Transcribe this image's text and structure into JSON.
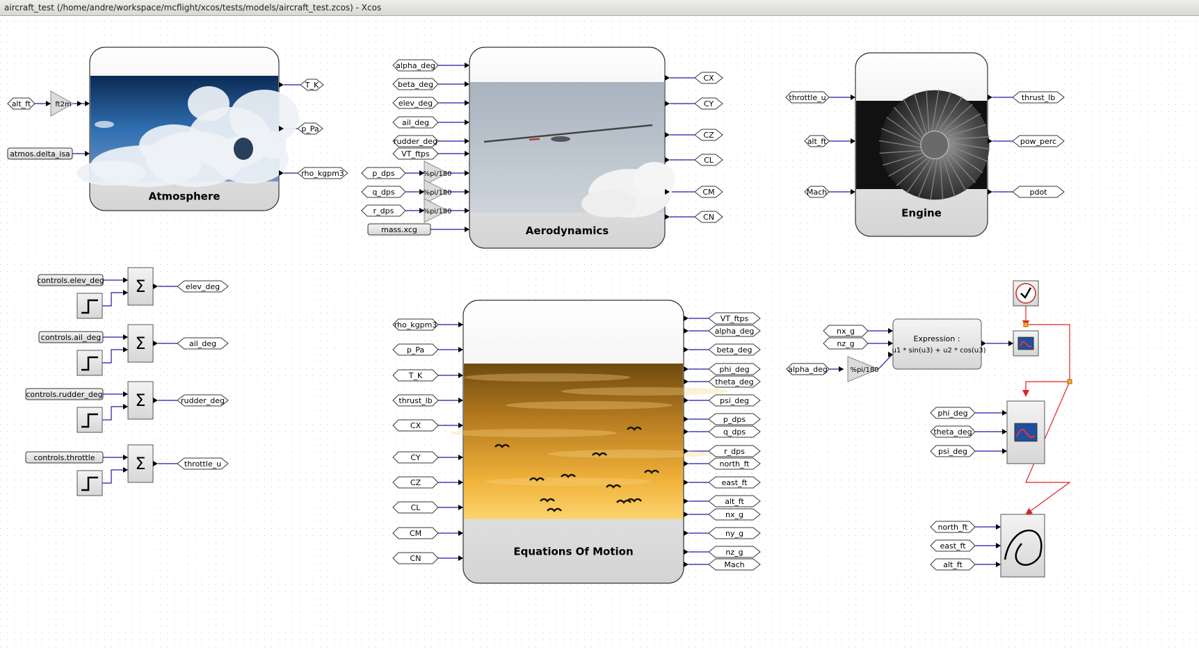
{
  "window": {
    "title": "aircraft_test (/home/andre/workspace/mcflight/xcos/tests/models/aircraft_test.zcos) - Xcos"
  },
  "superblocks": {
    "atmosphere": "Atmosphere",
    "aerodynamics": "Aerodynamics",
    "engine": "Engine",
    "eom": "Equations Of Motion"
  },
  "labels": {
    "alt_ft": "alt_ft",
    "ft2m": "ft2m",
    "atmos_delta_isa": "atmos.delta_isa",
    "T_K": "T_K",
    "p_Pa": "p_Pa",
    "rho_kgpm3": "rho_kgpm3",
    "alpha_deg": "alpha_deg",
    "beta_deg": "beta_deg",
    "elev_deg": "elev_deg",
    "ail_deg": "ail_deg",
    "rudder_deg": "rudder_deg",
    "VT_ftps": "VT_ftps",
    "p_dps": "p_dps",
    "q_dps": "q_dps",
    "r_dps": "r_dps",
    "pi180": "%pi/180",
    "mass_xcg": "mass.xcg",
    "CX": "CX",
    "CY": "CY",
    "CZ": "CZ",
    "CL": "CL",
    "CM": "CM",
    "CN": "CN",
    "throttle_u": "throttle_u",
    "Mach": "Mach",
    "thrust_lb": "thrust_lb",
    "pow_perc": "pow_perc",
    "pdot": "pdot",
    "controls_elev_deg": "controls.elev_deg",
    "controls_ail_deg": "controls.ail_deg",
    "controls_rudder_deg": "controls.rudder_deg",
    "controls_throttle": "controls.throttle",
    "phi_deg": "phi_deg",
    "theta_deg": "theta_deg",
    "psi_deg": "psi_deg",
    "north_ft": "north_ft",
    "east_ft": "east_ft",
    "nx_g": "nx_g",
    "ny_g": "ny_g",
    "nz_g": "nz_g",
    "expression_title": "Expression :",
    "expression_formula": "u1 * sin(u3) + u2 * cos(u3)"
  },
  "icons": {
    "sum": "sigma-icon",
    "step": "step-icon",
    "gain": "triangle-gain-icon",
    "clock": "clock-icon",
    "scope": "scope-icon",
    "xy_scope": "xy-scope-icon"
  },
  "colors": {
    "link": "#1a1aa8",
    "event_link": "#e02020",
    "grid_dot": "#c8c8c8"
  }
}
